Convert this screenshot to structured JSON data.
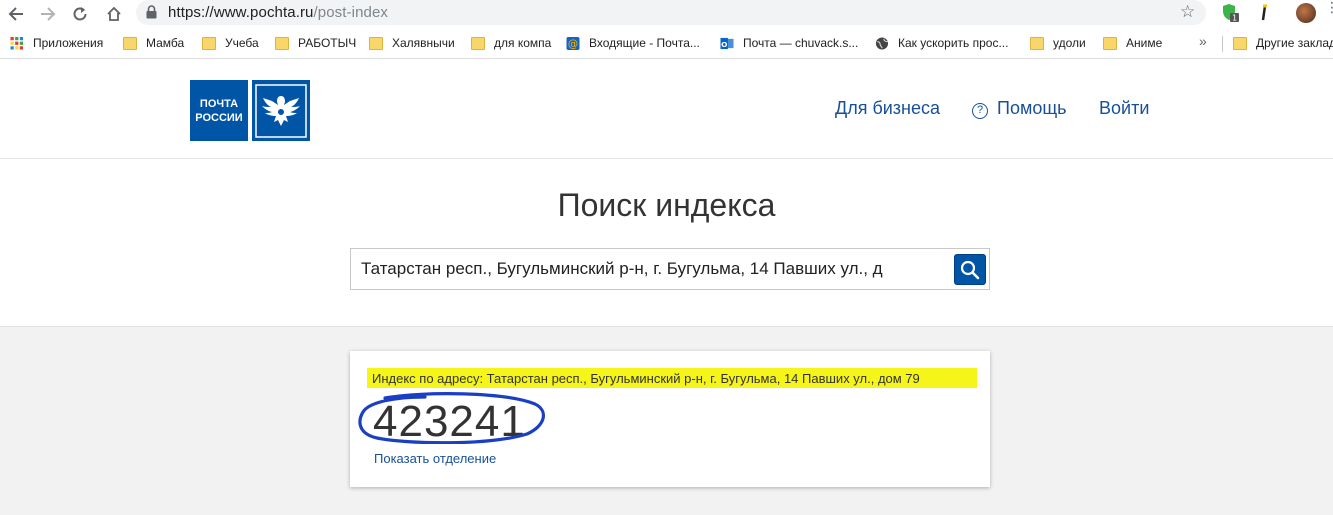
{
  "browser": {
    "url_main": "https://www.pochta.ru",
    "url_path": "/post-index",
    "extension_badge": "1",
    "bookmarks": [
      {
        "label": "Приложения",
        "icon": "apps-grid-icon"
      },
      {
        "label": "Мамба",
        "icon": "folder-icon"
      },
      {
        "label": "Учеба",
        "icon": "folder-icon"
      },
      {
        "label": "РАБОТЫЧ",
        "icon": "folder-icon"
      },
      {
        "label": "Халявнычи",
        "icon": "folder-icon"
      },
      {
        "label": "для компа",
        "icon": "folder-icon"
      },
      {
        "label": "Входящие - Почта...",
        "icon": "mail-at-icon"
      },
      {
        "label": "Почта — chuvack.s...",
        "icon": "outlook-icon"
      },
      {
        "label": "Как ускорить прос...",
        "icon": "globe-icon"
      },
      {
        "label": "удоли",
        "icon": "folder-icon"
      },
      {
        "label": "Аниме",
        "icon": "folder-icon"
      },
      {
        "label": "Другие заклад",
        "icon": "folder-icon"
      }
    ],
    "more_bookmarks": "»"
  },
  "header": {
    "logo_line1": "ПОЧТА",
    "logo_line2": "РОССИИ",
    "nav_business": "Для бизнеса",
    "nav_help": "Помощь",
    "nav_login": "Войти"
  },
  "search": {
    "title": "Поиск индекса",
    "value": "Татарстан респ., Бугульминский р-н, г. Бугульма, 14 Павших ул., д"
  },
  "result": {
    "label": "Индекс по адресу: Татарстан респ., Бугульминский р-н, г. Бугульма, 14 Павших ул., дом 79",
    "postcode": "423241",
    "show_office": "Показать отделение"
  },
  "colors": {
    "brand_blue": "#0055a6",
    "link_blue": "#17509a",
    "highlight_yellow": "#f5f51a",
    "annotation_circle": "#1a3fc4"
  }
}
